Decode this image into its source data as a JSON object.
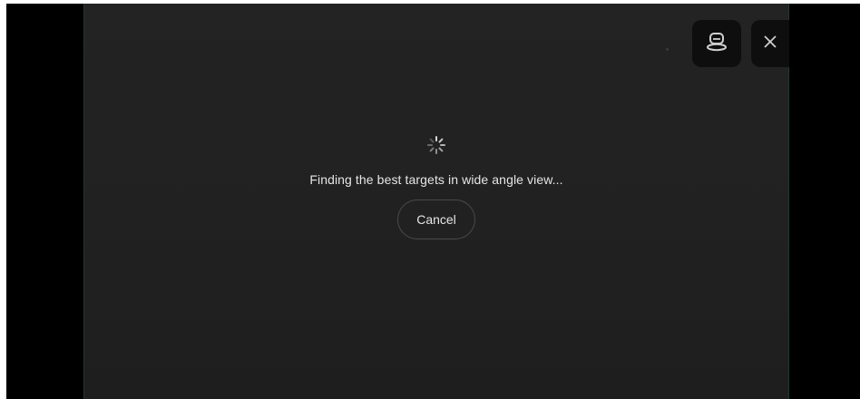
{
  "loading": {
    "message": "Finding the best targets in wide angle view...",
    "cancel_label": "Cancel"
  },
  "controls": {
    "camera_icon": "camera-lens-icon",
    "close_icon": "close-icon"
  },
  "colors": {
    "viewport_background": "#222222",
    "control_background": "#0e0e0e",
    "text": "#e6e6e6"
  }
}
